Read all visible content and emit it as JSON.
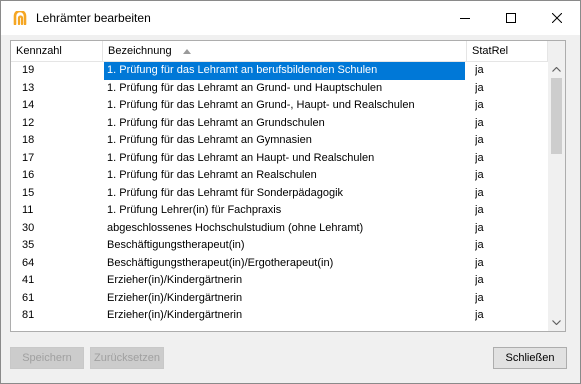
{
  "window": {
    "title": "Lehrämter bearbeiten",
    "accent_color": "#f5a623"
  },
  "table": {
    "columns": [
      {
        "label": "Kennzahl"
      },
      {
        "label": "Bezeichnung",
        "sort": "ascending"
      },
      {
        "label": "StatRel"
      }
    ],
    "selected_row": 0,
    "selection_color": "#0078d7",
    "rows": [
      {
        "kennzahl": "19",
        "bezeichnung": "1. Prüfung für das Lehramt an berufsbildenden Schulen",
        "statrel": "ja"
      },
      {
        "kennzahl": "13",
        "bezeichnung": "1. Prüfung für das Lehramt an Grund- und Hauptschulen",
        "statrel": "ja"
      },
      {
        "kennzahl": "14",
        "bezeichnung": "1. Prüfung für das Lehramt an Grund-, Haupt- und Realschulen",
        "statrel": "ja"
      },
      {
        "kennzahl": "12",
        "bezeichnung": "1. Prüfung für das Lehramt an Grundschulen",
        "statrel": "ja"
      },
      {
        "kennzahl": "18",
        "bezeichnung": "1. Prüfung für das Lehramt an Gymnasien",
        "statrel": "ja"
      },
      {
        "kennzahl": "17",
        "bezeichnung": "1. Prüfung für das Lehramt an Haupt- und Realschulen",
        "statrel": "ja"
      },
      {
        "kennzahl": "16",
        "bezeichnung": "1. Prüfung für das Lehramt an Realschulen",
        "statrel": "ja"
      },
      {
        "kennzahl": "15",
        "bezeichnung": "1. Prüfung für das Lehramt für Sonderpädagogik",
        "statrel": "ja"
      },
      {
        "kennzahl": "11",
        "bezeichnung": "1. Prüfung Lehrer(in) für Fachpraxis",
        "statrel": "ja"
      },
      {
        "kennzahl": "30",
        "bezeichnung": "abgeschlossenes Hochschulstudium (ohne Lehramt)",
        "statrel": "ja"
      },
      {
        "kennzahl": "35",
        "bezeichnung": "Beschäftigungstherapeut(in)",
        "statrel": "ja"
      },
      {
        "kennzahl": "64",
        "bezeichnung": "Beschäftigungstherapeut(in)/Ergotherapeut(in)",
        "statrel": "ja"
      },
      {
        "kennzahl": "41",
        "bezeichnung": "Erzieher(in)/Kindergärtnerin",
        "statrel": "ja"
      },
      {
        "kennzahl": "61",
        "bezeichnung": "Erzieher(in)/Kindergärtnerin",
        "statrel": "ja"
      },
      {
        "kennzahl": "81",
        "bezeichnung": "Erzieher(in)/Kindergärtnerin",
        "statrel": "ja"
      }
    ]
  },
  "buttons": {
    "save": {
      "label": "Speichern",
      "enabled": false
    },
    "reset": {
      "label": "Zurücksetzen",
      "enabled": false
    },
    "close": {
      "label": "Schließen",
      "enabled": true
    }
  }
}
